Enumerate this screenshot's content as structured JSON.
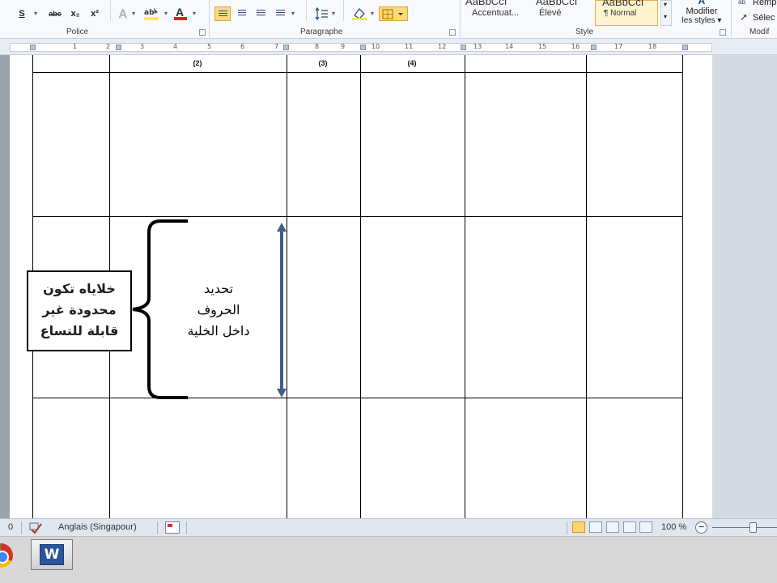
{
  "ribbon": {
    "font_buttons": {
      "strikethrough": "S",
      "strike_abc": "abc",
      "subscript": "x₂",
      "superscript": "x²",
      "font_color": "A"
    },
    "groups": {
      "police": "Police",
      "paragraphe": "Paragraphe",
      "style": "Style",
      "modifier": "Modif"
    },
    "styles": {
      "gallery_preview": "AaBbCcI",
      "items": [
        "Accentuat...",
        "Élevé",
        "¶ Normal"
      ],
      "modifier_line1": "Modifier",
      "modifier_line2": "les styles ▾"
    },
    "edit": {
      "replace": "Remp",
      "select": "Sélec"
    }
  },
  "ruler": {
    "numbers": [
      "1",
      "2",
      "3",
      "4",
      "5",
      "6",
      "7",
      "8",
      "9",
      "10",
      "11",
      "12",
      "13",
      "14",
      "15",
      "16",
      "17",
      "18"
    ]
  },
  "document": {
    "column_headers": [
      "(2)",
      "(3)",
      "(4)"
    ],
    "callout_lines": [
      "خلاياه تكون",
      "محدودة  غير",
      "قابلة للتساع"
    ],
    "cell_lines": [
      "تحديد",
      "الحروف",
      "داخل الخلية"
    ]
  },
  "statusbar": {
    "word_count_tail": "0",
    "language": "Anglais (Singapour)",
    "zoom": "100 %",
    "zoom_out": "−",
    "zoom_level_fraction": 0.5
  },
  "taskbar": {
    "word_logo": "W"
  },
  "colors": {
    "ribbon_bg": "#f7f9fc",
    "highlight": "#fcd97c",
    "arrow": "#3f5f86",
    "word_blue": "#2a5699"
  }
}
